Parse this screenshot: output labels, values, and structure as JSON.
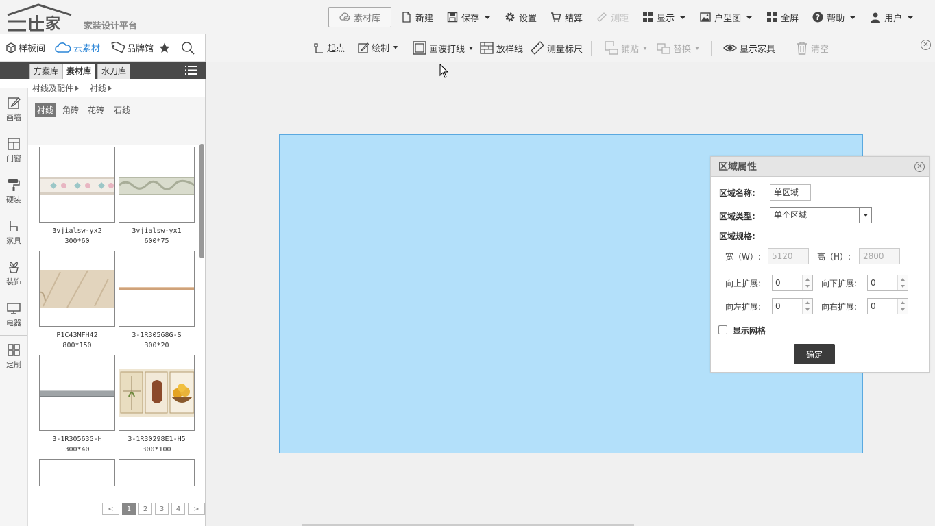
{
  "app": {
    "logo_subtitle": "家装设计平台"
  },
  "topmenu": {
    "library": "素材库",
    "new": "新建",
    "save": "保存",
    "settings": "设置",
    "checkout": "结算",
    "measure": "测距",
    "display": "显示",
    "floorplan": "户型图",
    "fullscreen": "全屏",
    "help": "帮助",
    "user": "用户"
  },
  "leftpanel": {
    "top": {
      "showroom": "样板间",
      "cloud": "云素材",
      "brand": "品牌馆"
    },
    "tabs": [
      "方案库",
      "素材库",
      "水刀库"
    ],
    "active_tab": "素材库",
    "breadcrumb": [
      "衬线及配件",
      "衬线"
    ],
    "filters": [
      "衬线",
      "角砖",
      "花砖",
      "石线"
    ],
    "active_filter": "衬线",
    "vnav": [
      "画墙",
      "门窗",
      "硬装",
      "家具",
      "装饰",
      "电器",
      "定制"
    ],
    "items": [
      {
        "name": "3vjialsw-yx2",
        "size": "300*60"
      },
      {
        "name": "3vjialsw-yx1",
        "size": "600*75"
      },
      {
        "name": "P1C43MFH42",
        "size": "800*150"
      },
      {
        "name": "3-1R30568G-S",
        "size": "300*20"
      },
      {
        "name": "3-1R30563G-H",
        "size": "300*40"
      },
      {
        "name": "3-1R30298E1-H5",
        "size": "300*100"
      }
    ],
    "pager": {
      "prev": "<",
      "pages": [
        "1",
        "2",
        "3",
        "4"
      ],
      "current": "1",
      "next": ">"
    }
  },
  "toolbar2": {
    "start": "起点",
    "draw": "绘制",
    "wave": "画波打线",
    "sample": "放样线",
    "ruler": "测量标尺",
    "tile": "铺贴",
    "replace": "替换",
    "show_furniture": "显示家具",
    "clear": "清空"
  },
  "area_panel": {
    "title": "区域属性",
    "name_label": "区域名称:",
    "name_value": "单区域",
    "type_label": "区域类型:",
    "type_value": "单个区域",
    "spec_label": "区域规格:",
    "width_label": "宽（W）:",
    "width_value": "5120",
    "height_label": "高（H）:",
    "height_value": "2800",
    "up_label": "向上扩展:",
    "up_value": "0",
    "down_label": "向下扩展:",
    "down_value": "0",
    "left_label": "向左扩展:",
    "left_value": "0",
    "right_label": "向右扩展:",
    "right_value": "0",
    "grid_label": "显示网格",
    "grid_checked": false,
    "confirm": "确定"
  },
  "colors": {
    "room_fill": "#b3e0fa",
    "room_border": "#5aa9e0",
    "accent": "#2c86d7"
  }
}
